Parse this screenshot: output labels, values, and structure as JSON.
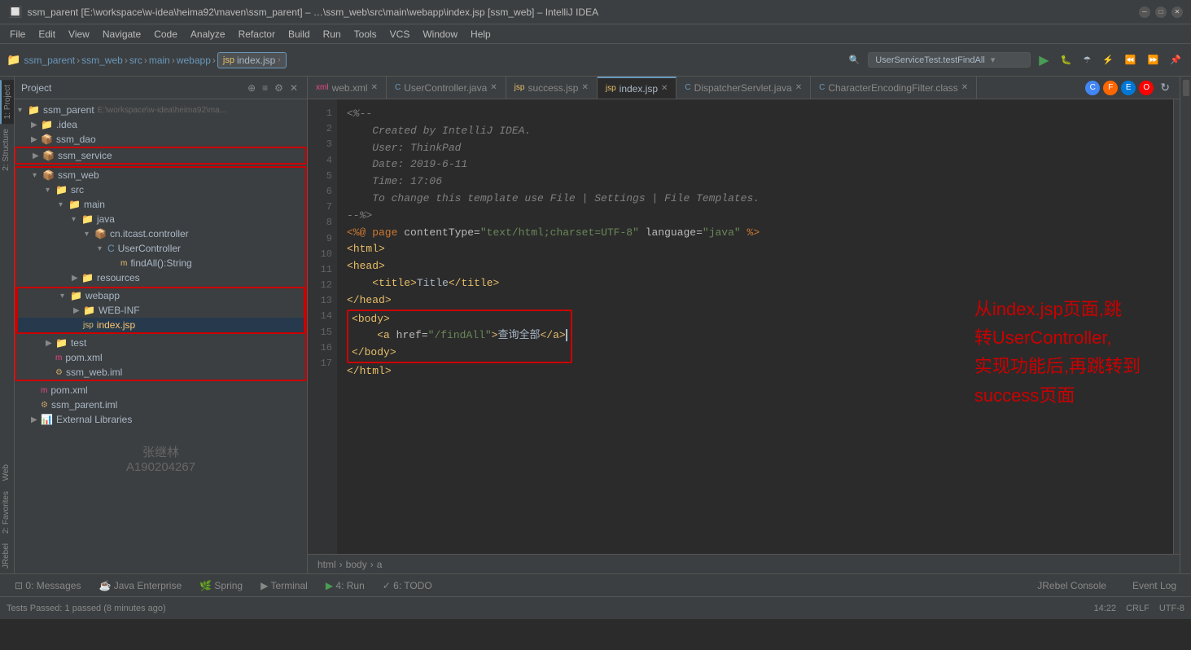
{
  "window": {
    "title": "ssm_parent [E:\\workspace\\w-idea\\heima92\\maven\\ssm_parent] – …\\ssm_web\\src\\main\\webapp\\index.jsp [ssm_web] – IntelliJ IDEA"
  },
  "menu": {
    "items": [
      "File",
      "Edit",
      "View",
      "Navigate",
      "Code",
      "Analyze",
      "Refactor",
      "Build",
      "Run",
      "Tools",
      "VCS",
      "Window",
      "Help"
    ]
  },
  "breadcrumb": {
    "items": [
      "ssm_parent",
      "ssm_web",
      "src",
      "main",
      "webapp"
    ],
    "current": "index.jsp"
  },
  "run_config": {
    "label": "UserServiceTest.testFindAll"
  },
  "tabs": [
    {
      "label": "web.xml",
      "type": "xml",
      "active": false
    },
    {
      "label": "UserController.java",
      "type": "java",
      "active": false
    },
    {
      "label": "success.jsp",
      "type": "jsp",
      "active": false
    },
    {
      "label": "index.jsp",
      "type": "jsp",
      "active": true
    },
    {
      "label": "DispatcherServlet.java",
      "type": "java",
      "active": false
    },
    {
      "label": "CharacterEncodingFilter.class",
      "type": "class",
      "active": false
    }
  ],
  "project_panel": {
    "title": "Project",
    "root": {
      "name": "ssm_parent",
      "path": "E:\\workspace\\w-idea\\heima92\\ma...",
      "children": [
        {
          "name": ".idea",
          "type": "folder",
          "expanded": false
        },
        {
          "name": "ssm_dao",
          "type": "module",
          "expanded": false
        },
        {
          "name": "ssm_service",
          "type": "module",
          "expanded": false,
          "highlighted": true
        },
        {
          "name": "ssm_web",
          "type": "module",
          "expanded": true,
          "highlighted": true,
          "children": [
            {
              "name": "src",
              "type": "folder",
              "expanded": true,
              "children": [
                {
                  "name": "main",
                  "type": "folder",
                  "expanded": true,
                  "children": [
                    {
                      "name": "java",
                      "type": "folder",
                      "expanded": true,
                      "children": [
                        {
                          "name": "cn.itcast.controller",
                          "type": "package",
                          "expanded": true,
                          "children": [
                            {
                              "name": "UserController",
                              "type": "class",
                              "expanded": true,
                              "children": [
                                {
                                  "name": "findAll():String",
                                  "type": "method"
                                }
                              ]
                            }
                          ]
                        }
                      ]
                    },
                    {
                      "name": "resources",
                      "type": "folder",
                      "expanded": false
                    }
                  ]
                },
                {
                  "name": "webapp",
                  "type": "folder",
                  "expanded": true,
                  "highlighted": true,
                  "children": [
                    {
                      "name": "WEB-INF",
                      "type": "folder",
                      "expanded": false
                    },
                    {
                      "name": "index.jsp",
                      "type": "jsp",
                      "selected": true
                    }
                  ]
                }
              ]
            },
            {
              "name": "test",
              "type": "folder",
              "expanded": false
            },
            {
              "name": "pom.xml",
              "type": "xml"
            },
            {
              "name": "ssm_web.iml",
              "type": "iml"
            }
          ]
        }
      ]
    }
  },
  "code": {
    "lines": [
      {
        "n": 1,
        "text": "<%--"
      },
      {
        "n": 2,
        "text": "    Created by IntelliJ IDEA."
      },
      {
        "n": 3,
        "text": "    User: ThinkPad"
      },
      {
        "n": 4,
        "text": "    Date: 2019-6-11"
      },
      {
        "n": 5,
        "text": "    Time: 17:06"
      },
      {
        "n": 6,
        "text": "    To change this template use File | Settings | File Templates."
      },
      {
        "n": 7,
        "text": "--%>"
      },
      {
        "n": 8,
        "text": "<%@ page contentType=\"text/html;charset=UTF-8\" language=\"java\" %>"
      },
      {
        "n": 9,
        "text": "<html>"
      },
      {
        "n": 10,
        "text": "<head>"
      },
      {
        "n": 11,
        "text": "    <title>Title</title>"
      },
      {
        "n": 12,
        "text": "</head>"
      },
      {
        "n": 13,
        "text": "<body>"
      },
      {
        "n": 14,
        "text": "    <a href=\"/findAll\">查询全部</a>"
      },
      {
        "n": 15,
        "text": "</body>"
      },
      {
        "n": 16,
        "text": "</html>"
      },
      {
        "n": 17,
        "text": ""
      }
    ]
  },
  "annotation": {
    "line1": "从index.jsp页面,跳",
    "line2": "转UserController,",
    "line3": "实现功能后,再跳转到",
    "line4": "success页面"
  },
  "watermark": {
    "name": "张继林",
    "id": "A190204267"
  },
  "bottom_breadcrumb": {
    "items": [
      "html",
      "body",
      "a"
    ]
  },
  "bottom_tabs": [
    {
      "label": "0: Messages",
      "icon": "message"
    },
    {
      "label": "Java Enterprise",
      "icon": "java"
    },
    {
      "label": "Spring",
      "icon": "spring"
    },
    {
      "label": "Terminal",
      "icon": "terminal"
    },
    {
      "label": "4: Run",
      "icon": "run"
    },
    {
      "label": "6: TODO",
      "icon": "todo"
    }
  ],
  "status_bar": {
    "message": "Tests Passed: 1 passed (8 minutes ago)",
    "jrebel": "JRebel Console",
    "event_log": "Event Log",
    "time": "14:22",
    "encoding": "CRLF",
    "charset": "UTF-8"
  }
}
